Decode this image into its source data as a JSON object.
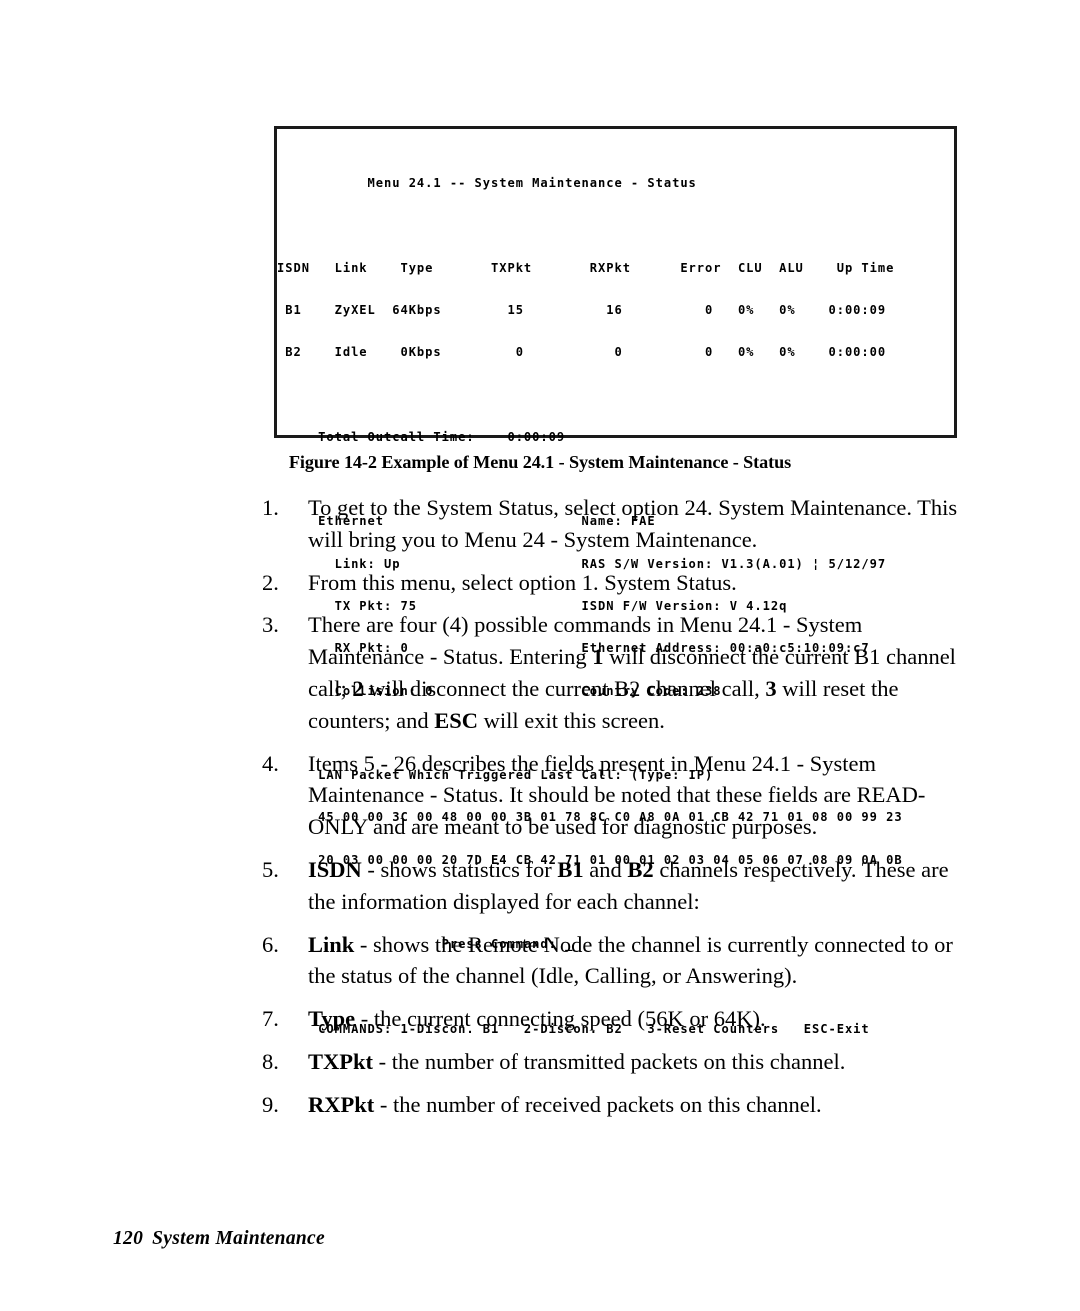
{
  "figure": {
    "caption": "Figure 14-2 Example of Menu 24.1 - System Maintenance - Status",
    "terminal": {
      "title": "           Menu 24.1 -- System Maintenance - Status",
      "table_header": "ISDN   Link    Type       TXPkt       RXPkt      Error  CLU  ALU    Up Time",
      "table_row_b1": " B1    ZyXEL  64Kbps        15          16          0   0%   0%    0:00:09",
      "table_row_b2": " B2    Idle    0Kbps         0           0          0   0%   0%    0:00:00",
      "total_outcall": "     Total Outcall Time:    0:00:09",
      "ethernet_label": "     Ethernet                        Name: FAE",
      "ethernet_link": "       Link: Up                      RAS S/W Version: V1.3(A.01) ¦ 5/12/97",
      "ethernet_tx": "       TX Pkt: 75                    ISDN F/W Version: V 4.12q",
      "ethernet_rx": "       RX Pkt: 0                     Ethernet Address: 00:a0:c5:10:09:c7",
      "ethernet_coll": "       Collision: 0                  Country Code: 238",
      "lan_packet_label": "     LAN Packet Which Triggered Last Call: (Type: IP)",
      "lan_packet_hex_1": "     45 00 00 3C 00 48 00 00 3B 01 78 8C C0 A8 0A 01 CB 42 71 01 08 00 99 23",
      "lan_packet_hex_2": "     20 03 00 00 00 20 7D E4 CB 42 71 01 00 01 02 03 04 05 06 07 08 09 0A 0B",
      "press_command": "                    Press Command: _",
      "commands_line": "     COMMANDS: 1-Discon. B1   2-Discon. B2   3-Reset Counters   ESC-Exit"
    }
  },
  "steps": [
    {
      "number": "1.",
      "parts": [
        {
          "text": "To get to the System Status, select option 24. System Maintenance. This will bring you to Menu 24 - System Maintenance.",
          "bold": false
        }
      ]
    },
    {
      "number": "2.",
      "parts": [
        {
          "text": "From this menu, select option 1. System Status.",
          "bold": false
        }
      ]
    },
    {
      "number": "3.",
      "parts": [
        {
          "text": "There are four (4) possible commands in Menu 24.1 - System Maintenance - Status. Entering ",
          "bold": false
        },
        {
          "text": "1",
          "bold": true
        },
        {
          "text": " will disconnect the current B1 channel call; ",
          "bold": false
        },
        {
          "text": "2",
          "bold": true
        },
        {
          "text": " will disconnect the current B2 channel call, ",
          "bold": false
        },
        {
          "text": "3",
          "bold": true
        },
        {
          "text": " will reset the counters; and ",
          "bold": false
        },
        {
          "text": "ESC",
          "bold": true
        },
        {
          "text": " will exit this screen.",
          "bold": false
        }
      ]
    },
    {
      "number": "4.",
      "parts": [
        {
          "text": "Items 5 - 26 describes the fields present in Menu 24.1 - System Maintenance - Status. It should be noted that these fields are READ-ONLY and are meant to be used for diagnostic purposes.",
          "bold": false
        }
      ]
    },
    {
      "number": "5.",
      "parts": [
        {
          "text": "ISDN",
          "bold": true
        },
        {
          "text": " - shows statistics for ",
          "bold": false
        },
        {
          "text": "B1",
          "bold": true
        },
        {
          "text": " and ",
          "bold": false
        },
        {
          "text": "B2",
          "bold": true
        },
        {
          "text": " channels respectively. These are the information displayed for each channel:",
          "bold": false
        }
      ]
    },
    {
      "number": "6.",
      "parts": [
        {
          "text": "Link",
          "bold": true
        },
        {
          "text": " - shows the Remote Node the channel is currently connected to or the status of the channel (Idle, Calling, or Answering).",
          "bold": false
        }
      ]
    },
    {
      "number": "7.",
      "parts": [
        {
          "text": "Type",
          "bold": true
        },
        {
          "text": " - the current connecting speed (56K or 64K).",
          "bold": false
        }
      ]
    },
    {
      "number": "8.",
      "parts": [
        {
          "text": "TXPkt",
          "bold": true
        },
        {
          "text": " - the number of transmitted packets on this channel.",
          "bold": false
        }
      ]
    },
    {
      "number": "9.",
      "parts": [
        {
          "text": "RXPkt",
          "bold": true
        },
        {
          "text": " - the number of received packets on this channel.",
          "bold": false
        }
      ]
    }
  ],
  "footer": {
    "page_number": "120",
    "section_title": "System Maintenance"
  }
}
